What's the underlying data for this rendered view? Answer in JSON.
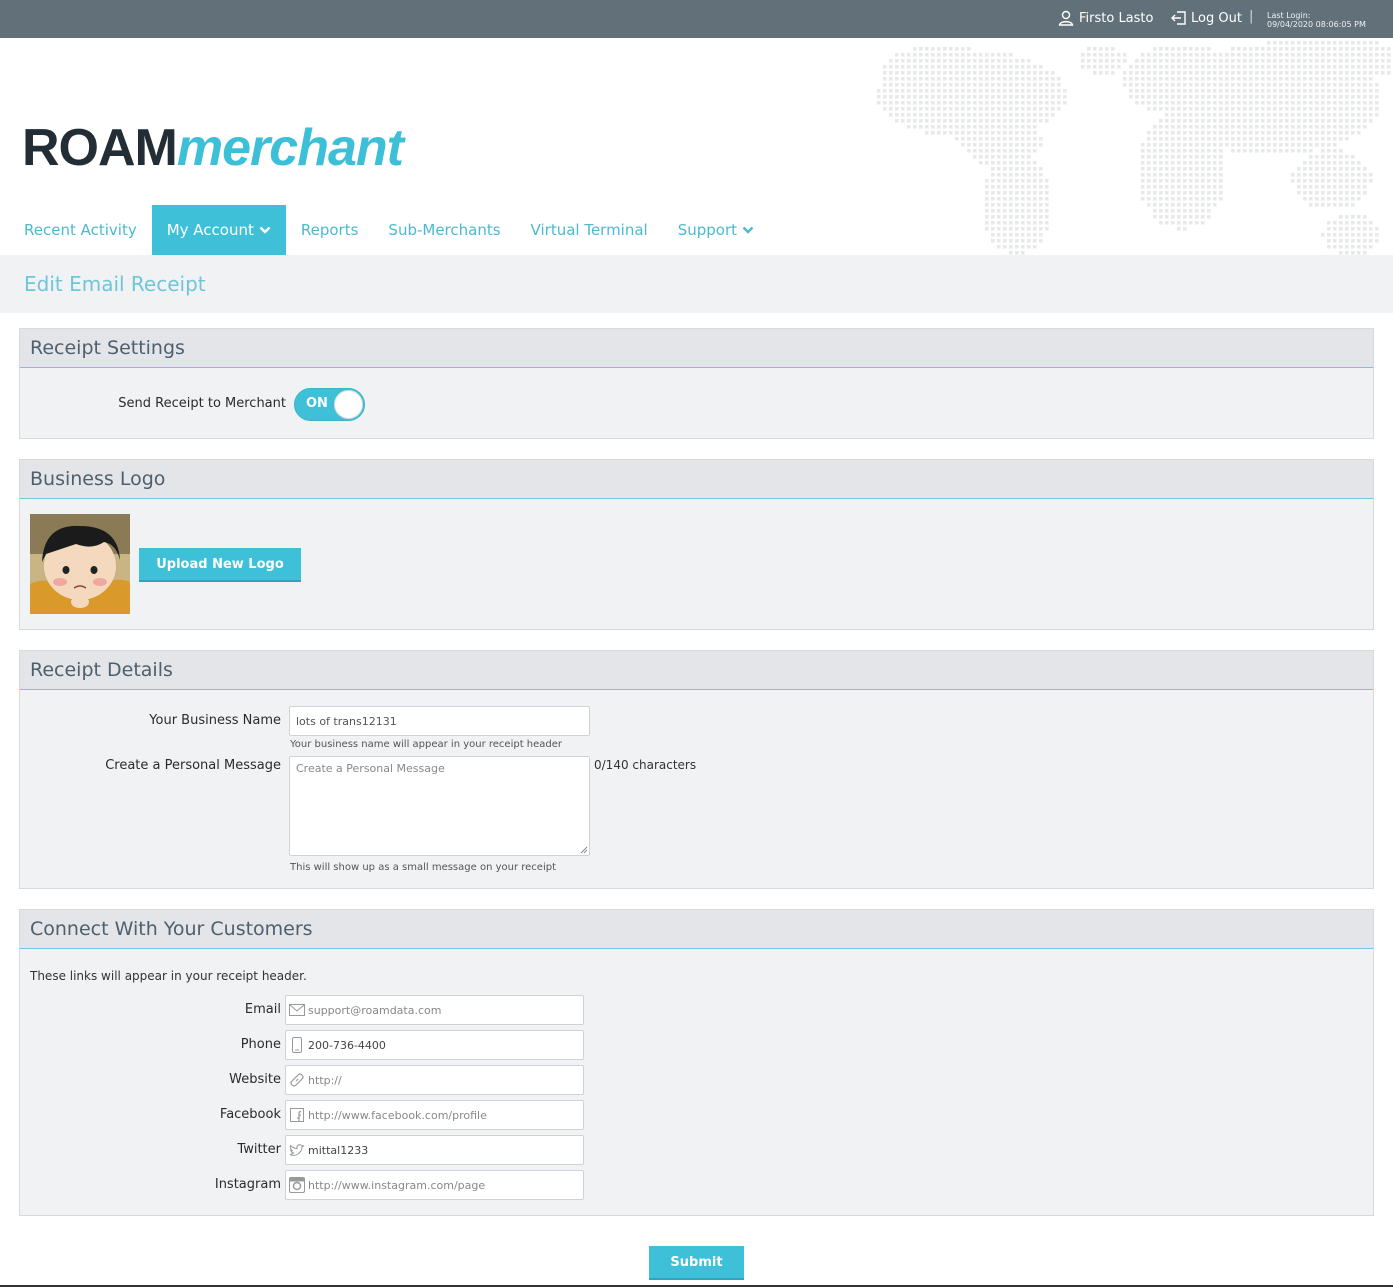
{
  "topbar": {
    "user_name": "Firsto Lasto",
    "logout_label": "Log Out",
    "separator": "|",
    "last_login_label": "Last Login:",
    "last_login_value": "09/04/2020 08:06:05 PM"
  },
  "brand": {
    "roam": "ROAM",
    "merchant": "merchant"
  },
  "nav": {
    "recent_activity": "Recent Activity",
    "my_account": "My Account",
    "reports": "Reports",
    "sub_merchants": "Sub-Merchants",
    "virtual_terminal": "Virtual Terminal",
    "support": "Support"
  },
  "page_title": "Edit Email Receipt",
  "receipt_settings": {
    "title": "Receipt Settings",
    "send_label": "Send Receipt to Merchant",
    "toggle_state": "ON"
  },
  "business_logo": {
    "title": "Business Logo",
    "upload_label": "Upload New Logo"
  },
  "receipt_details": {
    "title": "Receipt Details",
    "business_name_label": "Your Business Name",
    "business_name_value": "lots of trans12131",
    "business_name_hint": "Your business name will appear in your receipt header",
    "message_label": "Create a Personal Message",
    "message_placeholder": "Create a Personal Message",
    "message_count": "0/140 characters",
    "message_hint": "This will show up as a small message on your receipt"
  },
  "connect": {
    "title": "Connect With Your Customers",
    "intro": "These links will appear in your receipt header.",
    "email_label": "Email",
    "email_placeholder": "support@roamdata.com",
    "phone_label": "Phone",
    "phone_value": "200-736-4400",
    "website_label": "Website",
    "website_placeholder": "http://",
    "facebook_label": "Facebook",
    "facebook_placeholder": "http://www.facebook.com/profile",
    "twitter_label": "Twitter",
    "twitter_value": "mittal1233",
    "instagram_label": "Instagram",
    "instagram_placeholder": "http://www.instagram.com/page"
  },
  "submit_label": "Submit",
  "colors": {
    "accent": "#3ec1d8",
    "topbar": "#627079",
    "panel_bg": "#f1f2f4",
    "brand_dark": "#222d35"
  }
}
